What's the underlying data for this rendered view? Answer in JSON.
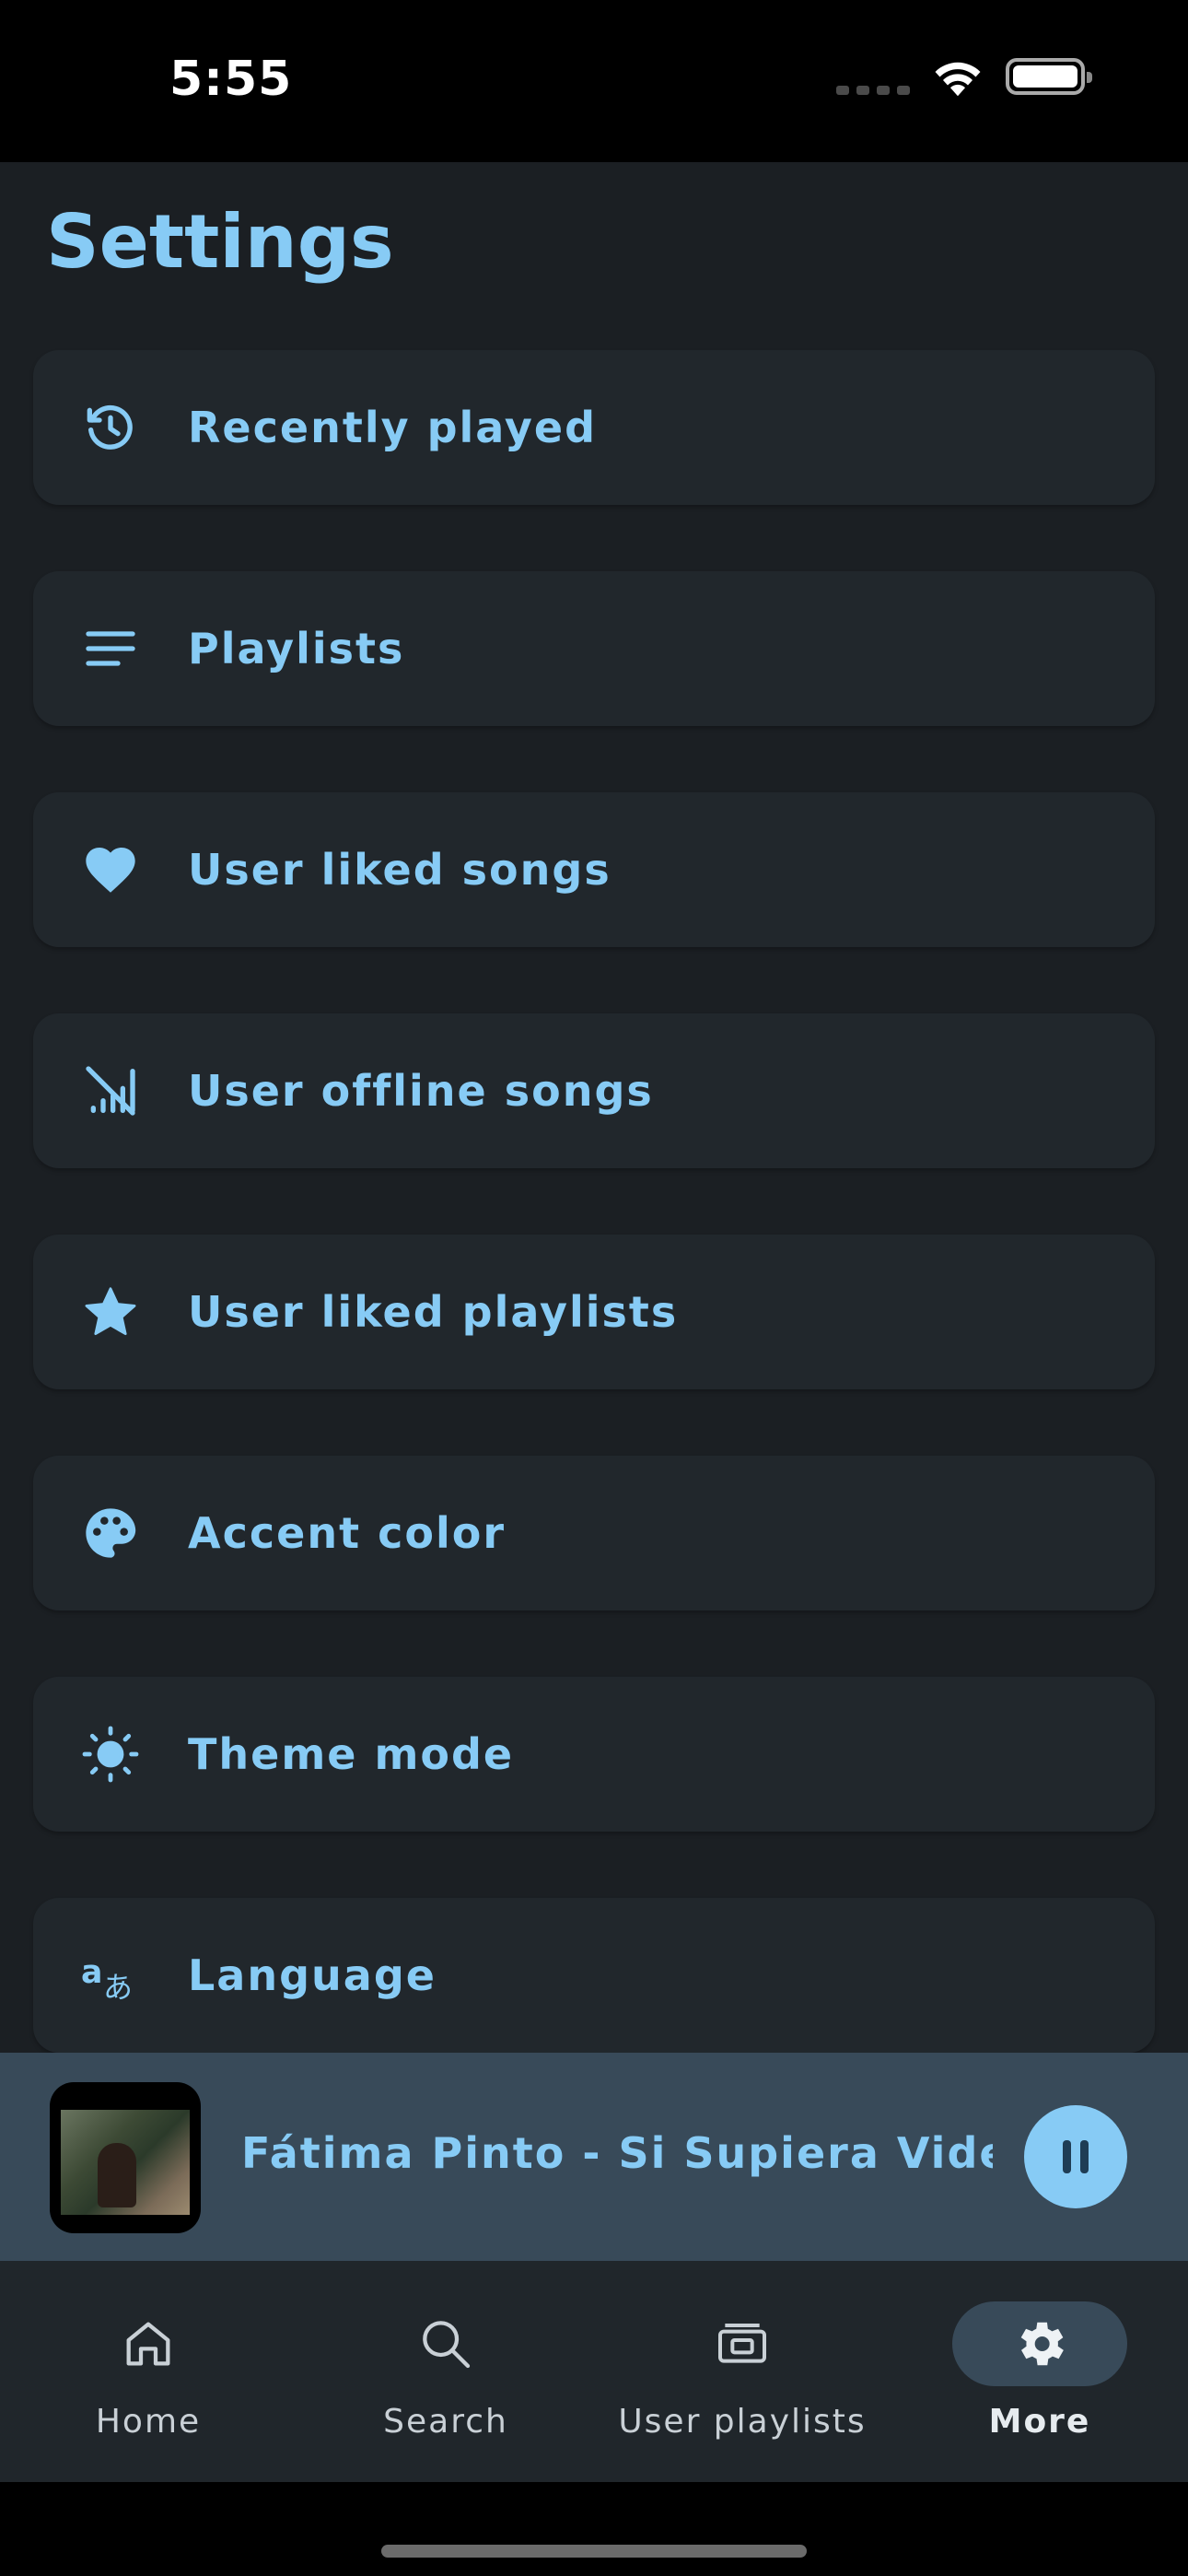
{
  "status_bar": {
    "time": "5:55"
  },
  "header": {
    "title": "Settings"
  },
  "settings": {
    "items": [
      {
        "label": "Recently played",
        "icon": "history-icon"
      },
      {
        "label": "Playlists",
        "icon": "list-icon"
      },
      {
        "label": "User liked songs",
        "icon": "heart-icon"
      },
      {
        "label": "User offline songs",
        "icon": "signal-off-icon"
      },
      {
        "label": "User liked playlists",
        "icon": "star-icon"
      },
      {
        "label": "Accent color",
        "icon": "palette-icon"
      },
      {
        "label": "Theme mode",
        "icon": "sun-icon"
      },
      {
        "label": "Language",
        "icon": "translate-icon"
      }
    ]
  },
  "player": {
    "track_title": "Fátima Pinto  - Si Supiera Video Oficial",
    "state_icon": "pause-icon"
  },
  "bottom_nav": {
    "items": [
      {
        "label": "Home",
        "icon": "home-icon"
      },
      {
        "label": "Search",
        "icon": "search-icon"
      },
      {
        "label": "User playlists",
        "icon": "library-icon"
      },
      {
        "label": "More",
        "icon": "gear-icon",
        "active": true
      }
    ]
  },
  "colors": {
    "accent": "#87cbf5",
    "background": "#1b1f23",
    "card": "#21272c",
    "player_bg": "#384a59"
  }
}
